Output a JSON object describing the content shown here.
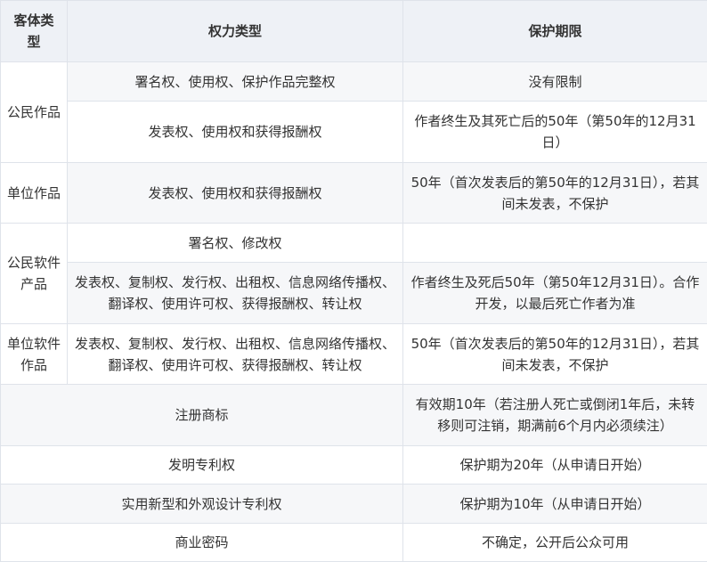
{
  "header": {
    "col1": "客体类型",
    "col2": "权力类型",
    "col3": "保护期限"
  },
  "rows": [
    {
      "category": "公民作品",
      "right": "署名权、使用权、保护作品完整权",
      "period": "没有限制"
    },
    {
      "category": "",
      "right": "发表权、使用权和获得报酬权",
      "period": "作者终生及其死亡后的50年（第50年的12月31日）"
    },
    {
      "category": "单位作品",
      "right": "发表权、使用权和获得报酬权",
      "period": "50年（首次发表后的第50年的12月31日），若其间未发表，不保护"
    },
    {
      "category": "公民软件产品",
      "right": "署名权、修改权",
      "period": ""
    },
    {
      "category": "",
      "right": "发表权、复制权、发行权、出租权、信息网络传播权、翻译权、使用许可权、获得报酬权、转让权",
      "period": "作者终生及死后50年（第50年12月31日）。合作开发，以最后死亡作者为准"
    },
    {
      "category": "单位软件作品",
      "right": "发表权、复制权、发行权、出租权、信息网络传播权、翻译权、使用许可权、获得报酬权、转让权",
      "period": "50年（首次发表后的第50年的12月31日），若其间未发表，不保护"
    },
    {
      "category": "",
      "right": "注册商标",
      "period": "有效期10年（若注册人死亡或倒闭1年后，未转移则可注销，期满前6个月内必须续注）"
    },
    {
      "category": "",
      "right": "发明专利权",
      "period": "保护期为20年（从申请日开始）"
    },
    {
      "category": "",
      "right": "实用新型和外观设计专利权",
      "period": "保护期为10年（从申请日开始）"
    },
    {
      "category": "",
      "right": "商业密码",
      "period": "不确定，公开后公众可用"
    }
  ]
}
